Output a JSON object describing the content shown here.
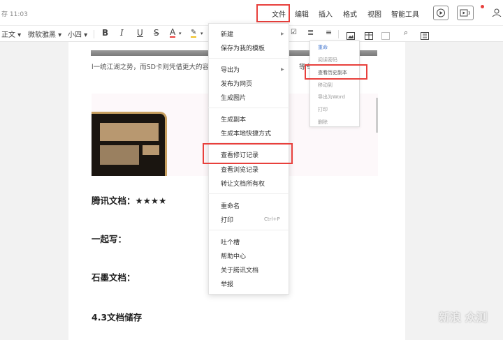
{
  "topbar": {
    "saved_status": "存 11:03",
    "menus": [
      "文件",
      "编辑",
      "插入",
      "格式",
      "视图",
      "智能工具"
    ]
  },
  "format_bar": {
    "style": "正文",
    "font": "微软雅黑",
    "size": "小四"
  },
  "document": {
    "paragraph": "l一统江湖之势，而SD卡则凭借更大的容量和",
    "paragraph_tail": "等专业领",
    "headings": {
      "tencent": "腾讯文档：",
      "tencent_stars": "★★★★",
      "yiqixie": "一起写：",
      "shimo": "石墨文档：",
      "storage": "4.3文档储存"
    },
    "watermark": "新浪 众测"
  },
  "history_popup": {
    "items": [
      "重命",
      "阅读密码",
      "查看历史副本",
      "移动到",
      "导出为Word",
      "打印",
      "删除"
    ]
  },
  "file_menu": {
    "groups": [
      [
        "新建",
        "保存为我的模板"
      ],
      [
        "导出为",
        "发布为网页",
        "生成图片"
      ],
      [
        "生成副本",
        "生成本地快捷方式"
      ],
      [
        "查看修订记录",
        "查看浏览记录",
        "转让文档所有权"
      ],
      [
        "重命名",
        "打印"
      ],
      [
        "吐个槽",
        "帮助中心",
        "关于腾讯文档",
        "举报"
      ]
    ],
    "print_shortcut": "Ctrl+P"
  }
}
